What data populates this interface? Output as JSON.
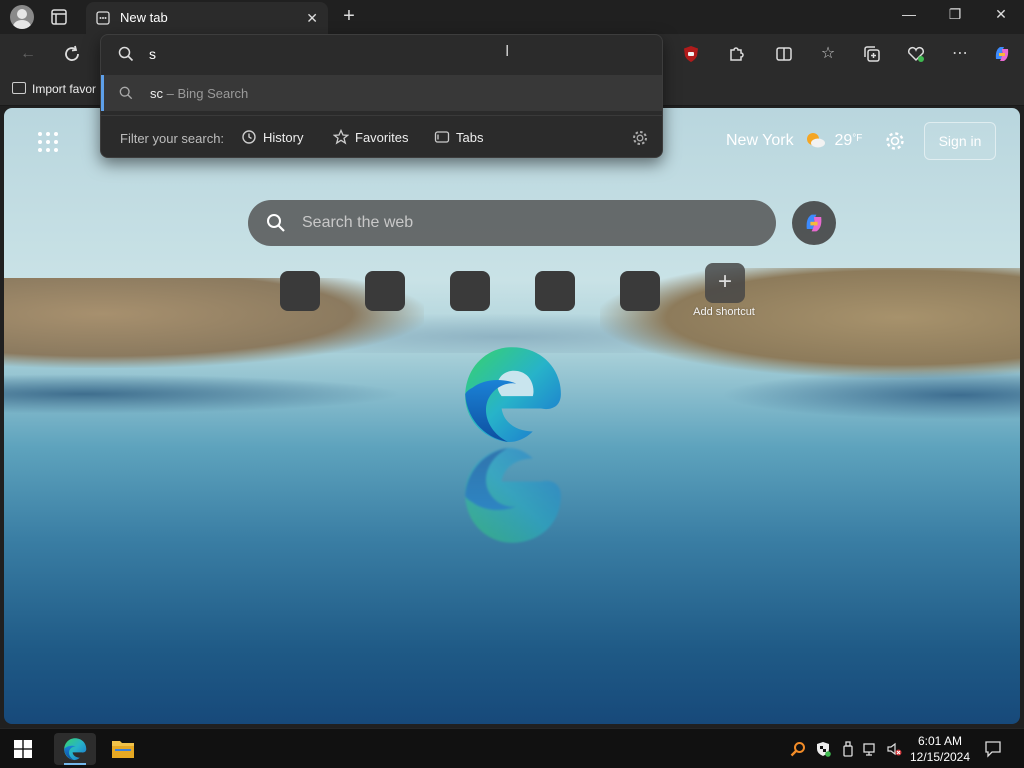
{
  "browser": {
    "tab": {
      "title": "New tab"
    },
    "address_bar": {
      "value": "s"
    },
    "bookmarks_bar": {
      "import_label": "Import favor"
    }
  },
  "omnibox_dropdown": {
    "suggestion": {
      "typed": "sc",
      "hint": "– Bing Search"
    },
    "filter_label": "Filter your search:",
    "filters": [
      {
        "label": "History",
        "icon": "history-icon"
      },
      {
        "label": "Favorites",
        "icon": "star-icon"
      },
      {
        "label": "Tabs",
        "icon": "tabs-icon"
      }
    ]
  },
  "new_tab_page": {
    "weather": {
      "location": "New York",
      "temperature": "29",
      "unit": "°F"
    },
    "sign_in_label": "Sign in",
    "search": {
      "placeholder": "Search the web"
    },
    "add_shortcut_label": "Add shortcut"
  },
  "taskbar": {
    "time": "6:01 AM",
    "date": "12/15/2024"
  },
  "colors": {
    "accent": "#5ea0ea",
    "frame": "#202020",
    "toolbar": "#2b2b2b"
  }
}
